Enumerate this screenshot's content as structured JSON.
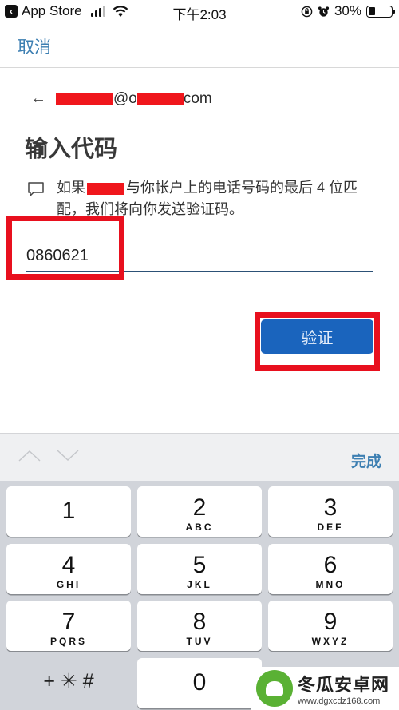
{
  "status_bar": {
    "back_app": "App Store",
    "time": "下午2:03",
    "battery_percent_text": "30%",
    "battery_level": 0.3,
    "signal_bars_filled": 3,
    "signal_bars_total": 4
  },
  "nav": {
    "cancel_label": "取消"
  },
  "account": {
    "email_visible_parts": [
      "@o",
      "com"
    ]
  },
  "page": {
    "title": "输入代码",
    "message_prefix": "如果",
    "message_suffix": "与你帐户上的电话号码的最后 4 位匹配，我们将向你发送验证码。",
    "code_value": "0860621",
    "verify_label": "验证"
  },
  "accessory": {
    "done_label": "完成"
  },
  "keypad": {
    "keys": [
      {
        "num": "1",
        "letters": ""
      },
      {
        "num": "2",
        "letters": "ABC"
      },
      {
        "num": "3",
        "letters": "DEF"
      },
      {
        "num": "4",
        "letters": "GHI"
      },
      {
        "num": "5",
        "letters": "JKL"
      },
      {
        "num": "6",
        "letters": "MNO"
      },
      {
        "num": "7",
        "letters": "PQRS"
      },
      {
        "num": "8",
        "letters": "TUV"
      },
      {
        "num": "9",
        "letters": "WXYZ"
      },
      {
        "num": "0",
        "letters": ""
      }
    ],
    "symbols_label": "+ ✳ #"
  },
  "watermark": {
    "name": "冬瓜安卓网",
    "url": "www.dgxcdz168.com"
  },
  "colors": {
    "accent_link": "#3d7fb2",
    "button_blue": "#1a64bd",
    "highlight_red": "#e8101e",
    "keypad_bg": "#d1d4da"
  }
}
